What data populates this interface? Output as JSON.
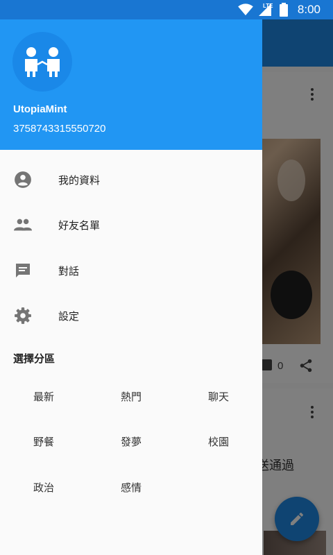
{
  "status_bar": {
    "time": "8:00",
    "network": "LTE"
  },
  "drawer": {
    "header": {
      "username": "UtopiaMint",
      "user_id": "3758743315550720"
    },
    "menu": [
      {
        "label": "我的資料",
        "icon": "account-circle-icon"
      },
      {
        "label": "好友名單",
        "icon": "people-icon"
      },
      {
        "label": "對話",
        "icon": "chat-icon"
      },
      {
        "label": "設定",
        "icon": "settings-icon"
      }
    ],
    "section_title": "選擇分區",
    "categories": [
      "最新",
      "熱門",
      "聊天",
      "野餐",
      "發夢",
      "校園",
      "政治",
      "感情"
    ]
  },
  "background": {
    "post": {
      "comment_count": "0"
    },
    "post2_text": "送通過"
  },
  "colors": {
    "primary": "#2196f3",
    "primary_dark": "#1976d2",
    "accent": "#1e88e5"
  }
}
